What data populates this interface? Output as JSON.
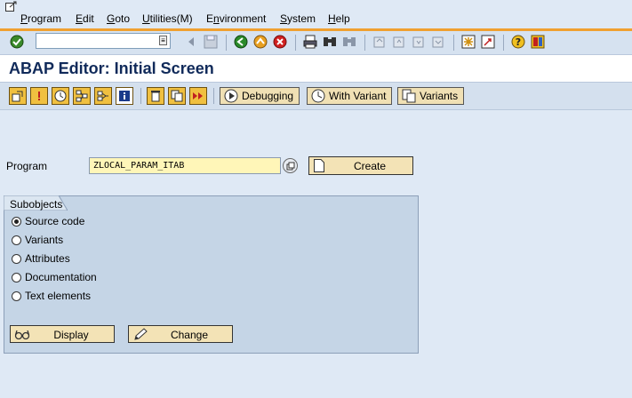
{
  "menu": [
    {
      "label": "Program",
      "key": "P"
    },
    {
      "label": "Edit",
      "key": "E"
    },
    {
      "label": "Goto",
      "key": "G"
    },
    {
      "label": "Utilities(M)",
      "key": "U"
    },
    {
      "label": "Environment",
      "key": "n"
    },
    {
      "label": "System",
      "key": "S"
    },
    {
      "label": "Help",
      "key": "H"
    }
  ],
  "command_field": {
    "value": ""
  },
  "title": "ABAP Editor: Initial Screen",
  "app_toolbar": {
    "debugging_label": "Debugging",
    "with_variant_label": "With Variant",
    "variants_label": "Variants"
  },
  "program": {
    "label": "Program",
    "value": "ZLOCAL_PARAM_ITAB",
    "create_label": "Create"
  },
  "subobjects": {
    "title": "Subobjects",
    "options": [
      "Source code",
      "Variants",
      "Attributes",
      "Documentation",
      "Text elements"
    ],
    "selected": "Source code",
    "display_label": "Display",
    "change_label": "Change"
  },
  "colors": {
    "accent_line": "#f0a030",
    "background": "#dfe9f5",
    "input_required": "#fff6b8",
    "button": "#f3e3b6"
  }
}
